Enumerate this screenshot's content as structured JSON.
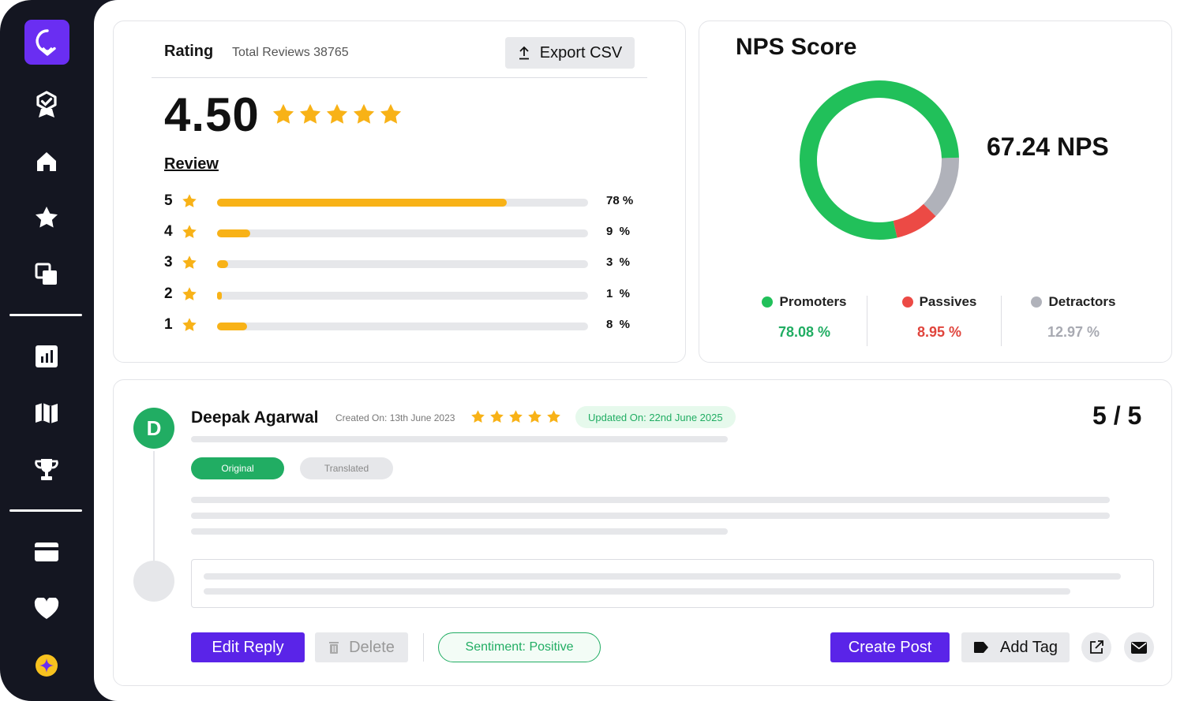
{
  "sidebar": {
    "icons": [
      "logo-icon",
      "badge-check-icon",
      "home-icon",
      "star-icon",
      "copy-icon",
      "chart-icon",
      "map-icon",
      "trophy-icon",
      "card-icon",
      "heart-icon",
      "sparkle-icon"
    ],
    "accent": "#6a2ef2"
  },
  "rating": {
    "title": "Rating",
    "total_reviews": "Total Reviews 38765",
    "export_label": "Export CSV",
    "score": "4.50",
    "star_count": 5,
    "review_link": "Review",
    "bars": [
      {
        "stars": "5",
        "percent_label": "78 %",
        "fill_fraction": 0.78
      },
      {
        "stars": "4",
        "percent_label": "9  %",
        "fill_fraction": 0.09
      },
      {
        "stars": "3",
        "percent_label": "3  %",
        "fill_fraction": 0.03
      },
      {
        "stars": "2",
        "percent_label": "1  %",
        "fill_fraction": 0.01
      },
      {
        "stars": "1",
        "percent_label": "8  %",
        "fill_fraction": 0.08
      }
    ]
  },
  "nps": {
    "title": "NPS Score",
    "value": "67.24 NPS",
    "legend": [
      {
        "name": "Promoters",
        "value": "78.08 %",
        "color": "#21c05a",
        "value_color": "#21ad63"
      },
      {
        "name": "Passives",
        "value": "8.95 %",
        "color": "#ec4a45",
        "value_color": "#e0453d"
      },
      {
        "name": "Detractors",
        "value": "12.97 %",
        "color": "#b0b2ba",
        "value_color": "#a8aab2"
      }
    ],
    "donut_segments": [
      {
        "name": "Promoters",
        "fraction": 0.7808,
        "color": "#21c05a"
      },
      {
        "name": "Passives",
        "fraction": 0.0895,
        "color": "#ec4a45"
      },
      {
        "name": "Detractors",
        "fraction": 0.1297,
        "color": "#b0b2ba"
      }
    ]
  },
  "review": {
    "avatar_initial": "D",
    "reviewer": "Deepak Agarwal",
    "created": "Created On: 13th June 2023",
    "updated": "Updated On: 22nd June 2025",
    "score": "5 / 5",
    "star_count": 5,
    "tab_original": "Original",
    "tab_translated": "Translated",
    "edit_reply": "Edit Reply",
    "delete": "Delete",
    "sentiment": "Sentiment: Positive",
    "create_post": "Create Post",
    "add_tag": "Add Tag"
  }
}
